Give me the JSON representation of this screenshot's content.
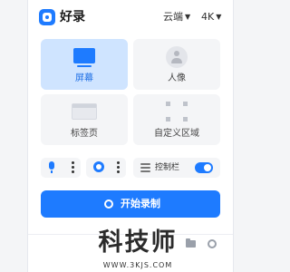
{
  "app": {
    "name": "好录"
  },
  "header": {
    "storage_label": "云端",
    "quality_label": "4K"
  },
  "modes": [
    {
      "label": "屏幕",
      "icon": "monitor-icon",
      "selected": true
    },
    {
      "label": "人像",
      "icon": "person-icon",
      "selected": false
    },
    {
      "label": "标签页",
      "icon": "browser-tab-icon",
      "selected": false
    },
    {
      "label": "自定义区域",
      "icon": "region-select-icon",
      "selected": false
    }
  ],
  "controls": {
    "mic_icon": "microphone-icon",
    "camera_icon": "camera-icon",
    "control_bar_label": "控制栏",
    "control_bar_enabled": true
  },
  "start_button": {
    "label": "开始录制"
  },
  "footer": {
    "icons": [
      "folder-icon",
      "settings-icon"
    ]
  },
  "watermark": {
    "title": "科技师",
    "url": "WWW.3KJS.COM"
  },
  "colors": {
    "accent": "#1e7bff",
    "selected_tile": "#cfe4ff",
    "panel_bg": "#ffffff"
  }
}
